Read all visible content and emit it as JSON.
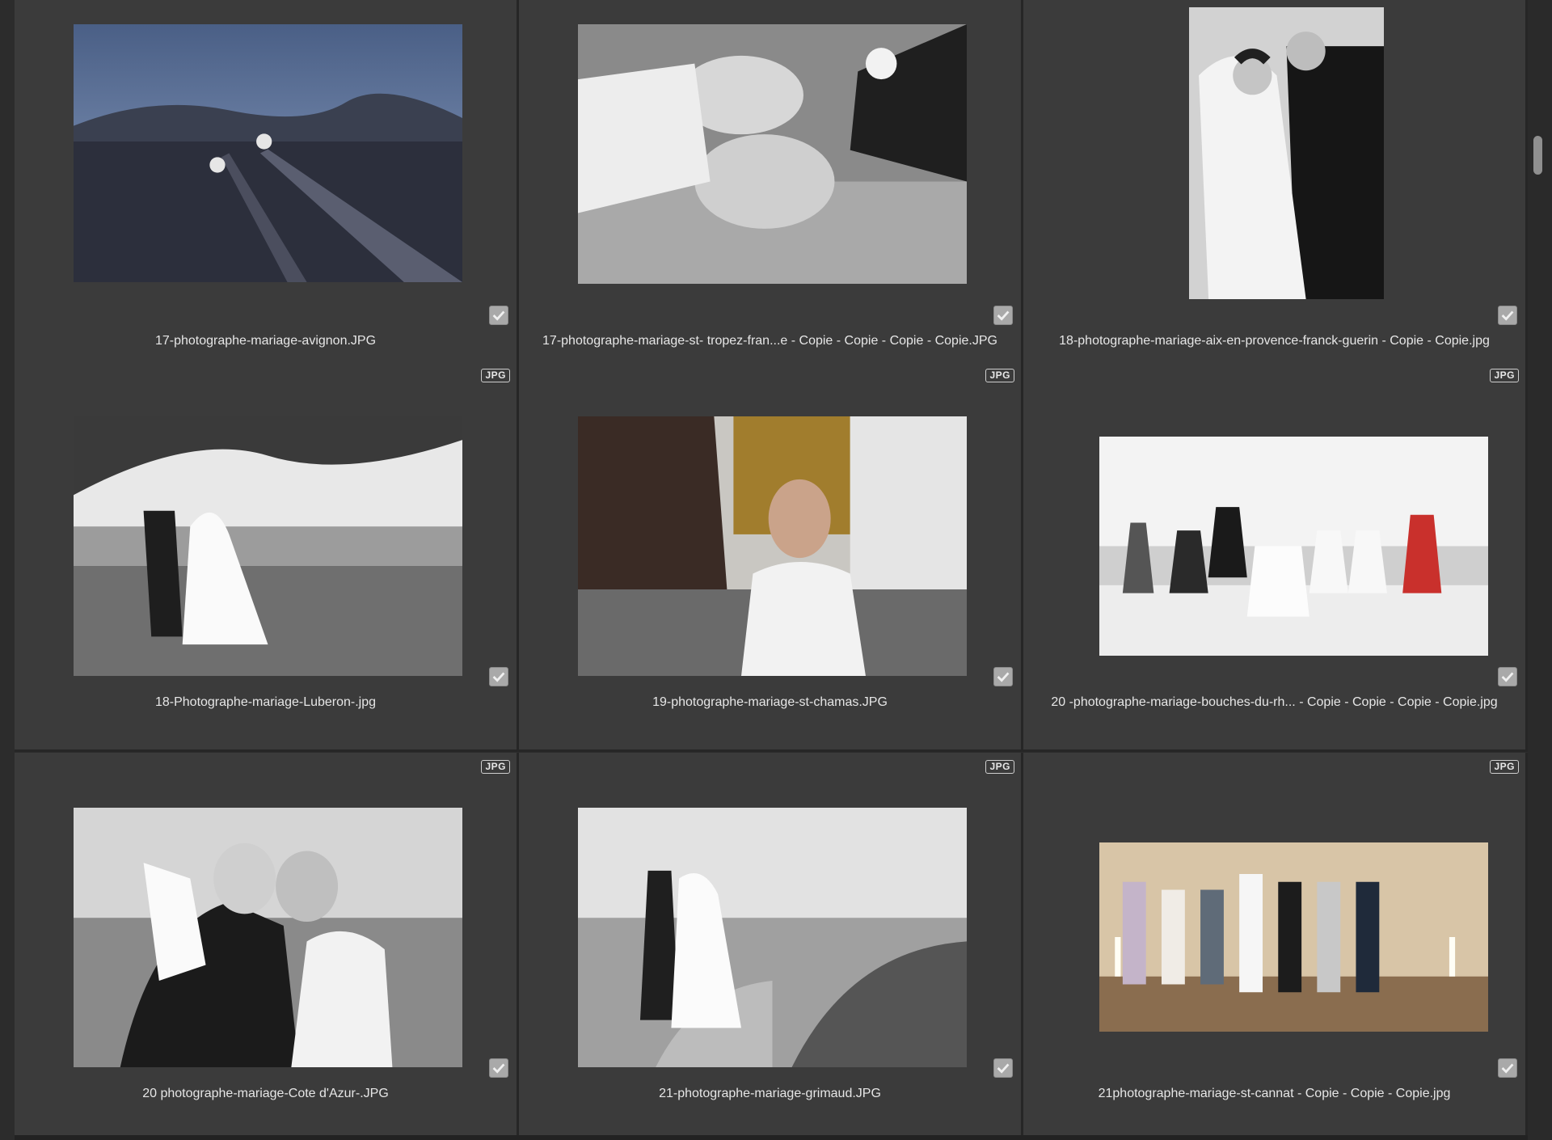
{
  "grid": {
    "items": [
      {
        "filename": "17-photographe-mariage-avignon.JPG",
        "badge": "",
        "checked": true,
        "icon": "photo-thumbnail"
      },
      {
        "filename": "17-photographe-mariage-st- tropez-fran...e - Copie - Copie - Copie - Copie.JPG",
        "badge": "",
        "checked": true,
        "icon": "photo-thumbnail"
      },
      {
        "filename": "18-photographe-mariage-aix-en-provence-franck-guerin - Copie - Copie.jpg",
        "badge": "",
        "checked": true,
        "icon": "photo-thumbnail"
      },
      {
        "filename": "18-Photographe-mariage-Luberon-.jpg",
        "badge": "JPG",
        "checked": true,
        "icon": "photo-thumbnail"
      },
      {
        "filename": "19-photographe-mariage-st-chamas.JPG",
        "badge": "JPG",
        "checked": true,
        "icon": "photo-thumbnail"
      },
      {
        "filename": "20 -photographe-mariage-bouches-du-rh... - Copie - Copie - Copie - Copie.jpg",
        "badge": "JPG",
        "checked": true,
        "icon": "photo-thumbnail"
      },
      {
        "filename": "20 photographe-mariage-Cote d'Azur-.JPG",
        "badge": "JPG",
        "checked": true,
        "icon": "photo-thumbnail"
      },
      {
        "filename": "21-photographe-mariage-grimaud.JPG",
        "badge": "JPG",
        "checked": true,
        "icon": "photo-thumbnail"
      },
      {
        "filename": "21photographe-mariage-st-cannat - Copie - Copie - Copie.jpg",
        "badge": "JPG",
        "checked": true,
        "icon": "photo-thumbnail"
      }
    ]
  },
  "colors": {
    "background": "#2c2c2c",
    "cell": "#3b3b3b",
    "text": "#e6e6e6",
    "checkbox": "#a9a9a9"
  },
  "icons": {
    "checkbox": "checkmark-icon",
    "scrollbar": "scroll-thumb"
  }
}
